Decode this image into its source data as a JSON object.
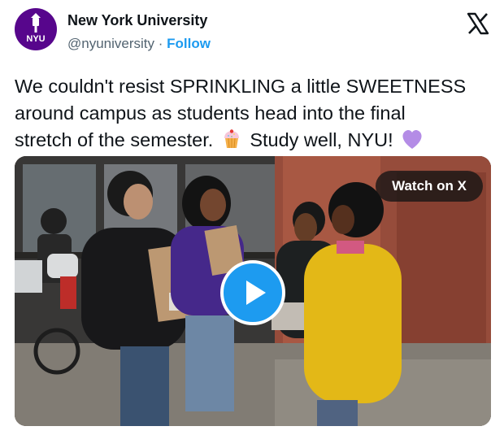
{
  "account": {
    "name": "New York University",
    "handle": "@nyuniversity",
    "separator": "·",
    "follow_label": "Follow",
    "avatar_text": "NYU",
    "avatar_color": "#57068c"
  },
  "platform": {
    "logo_icon": "x-logo-icon"
  },
  "tweet": {
    "text_line_1": "We couldn't resist SPRINKLING a little SWEETNESS",
    "text_line_2": "around campus as students head into the final",
    "text_line_3a": "stretch of the semester.",
    "text_line_3b": "Study well, NYU!",
    "emoji_1": "cupcake-icon",
    "emoji_2": "purple-heart-icon"
  },
  "media": {
    "type": "video",
    "watch_label": "Watch on X",
    "play_icon": "play-icon",
    "accent_color": "#1d9bf0"
  }
}
